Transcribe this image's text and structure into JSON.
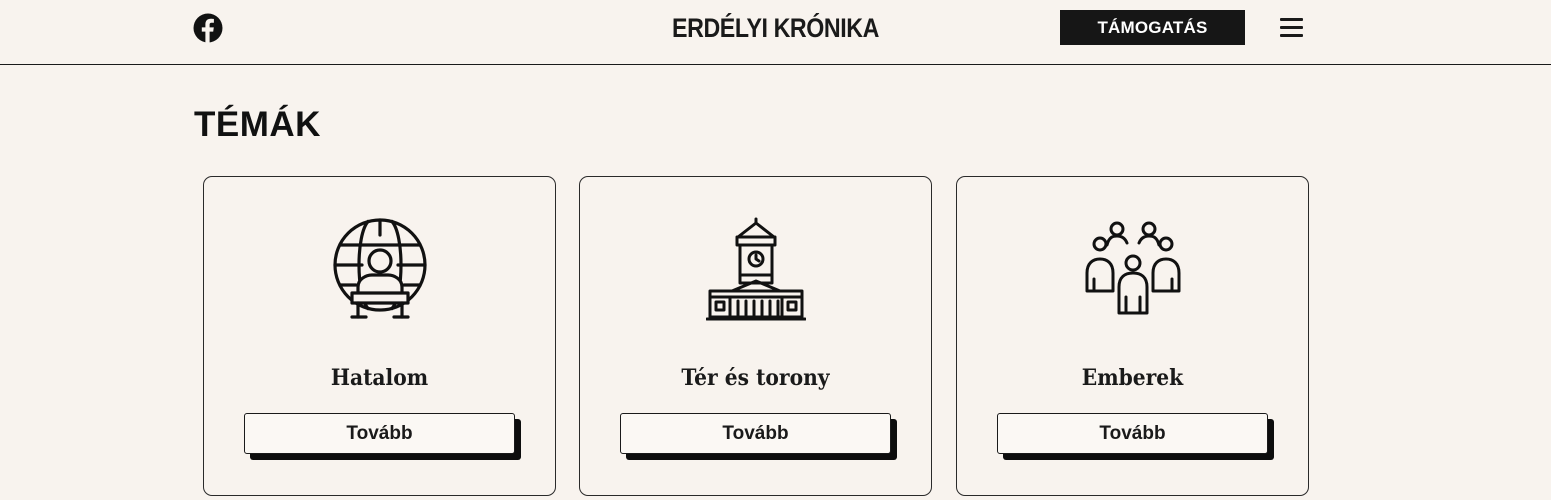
{
  "header": {
    "site_title": "ERDÉLYI KRÓNIKA",
    "support_label": "TÁMOGATÁS",
    "icons": {
      "social": "facebook-icon",
      "menu": "hamburger-menu-icon"
    }
  },
  "section": {
    "title": "TÉMÁK"
  },
  "cards": [
    {
      "title": "Hatalom",
      "icon": "globe-podium-speaker-icon",
      "button_label": "Tovább"
    },
    {
      "title": "Tér és torony",
      "icon": "clock-tower-building-icon",
      "button_label": "Tovább"
    },
    {
      "title": "Emberek",
      "icon": "people-group-icon",
      "button_label": "Tovább"
    }
  ],
  "colors": {
    "background": "#f8f3ee",
    "ink": "#161616",
    "button_text": "#ffffff"
  }
}
